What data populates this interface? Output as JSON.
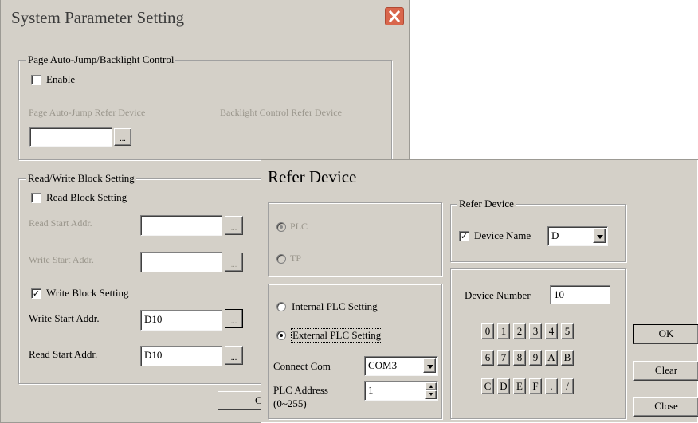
{
  "system_dialog": {
    "title": "System Parameter Setting",
    "auto_jump_group": {
      "legend": "Page Auto-Jump/Backlight Control",
      "enable_label": "Enable",
      "enable_checked": false,
      "auto_jump_label": "Page Auto-Jump Refer Device",
      "backlight_label": "Backlight Control Refer Device",
      "browse_label": "..."
    },
    "rw_group": {
      "legend": "Read/Write Block Setting",
      "read_block_label": "Read Block Setting",
      "read_block_checked": false,
      "read_start_label": "Read Start Addr.",
      "write_start_label": "Write Start Addr.",
      "write_block_label": "Write Block Setting",
      "write_block_checked": true,
      "write_start2_label": "Write Start Addr.",
      "write_start2_value": "D10",
      "read_start2_label": "Read Start Addr.",
      "read_start2_value": "D10",
      "browse_label": "..."
    },
    "bottom_button_fragment": "C"
  },
  "refer_dialog": {
    "title": "Refer Device",
    "target_group": {
      "plc_label": "PLC",
      "tp_label": "TP",
      "selected": "PLC"
    },
    "plc_setting_group": {
      "internal_label": "Internal PLC Setting",
      "external_label": "External PLC Setting",
      "selected": "External PLC Setting",
      "connect_com_label": "Connect Com",
      "connect_com_value": "COM3",
      "plc_address_label": "PLC Address",
      "plc_address_range": "(0~255)",
      "plc_address_value": "1"
    },
    "refer_device_group": {
      "legend": "Refer Device",
      "device_name_label": "Device Name",
      "device_name_checked": true,
      "device_name_value": "D"
    },
    "number_group": {
      "device_number_label": "Device Number",
      "device_number_value": "10",
      "keys_row1": [
        "0",
        "1",
        "2",
        "3",
        "4",
        "5"
      ],
      "keys_row2": [
        "6",
        "7",
        "8",
        "9",
        "A",
        "B"
      ],
      "keys_row3": [
        "C",
        "D",
        "E",
        "F",
        ".",
        "/"
      ]
    },
    "ok_label": "OK",
    "clear_label": "Clear",
    "close_label": "Close"
  },
  "colors": {
    "dialog_bg": "#d4d0c8",
    "close_button_red": "#d9664c",
    "disabled_text": "#9a968c"
  },
  "icons": [
    "close-x-icon",
    "checkmark-icon",
    "chevron-down-icon",
    "spin-arrows-icon"
  ]
}
